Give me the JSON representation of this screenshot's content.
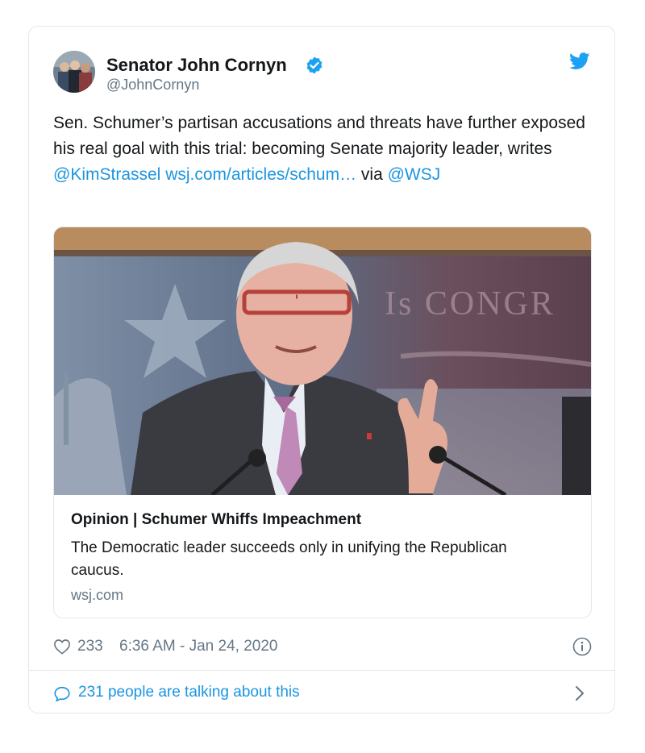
{
  "tweet": {
    "author_name": "Senator John Cornyn",
    "handle": "@JohnCornyn",
    "text": {
      "part1": "Sen. Schumer’s partisan accusations and threats have further exposed his real goal with this trial: becoming Senate majority leader, writes ",
      "mention1": "@KimStrassel",
      "space": " ",
      "url": "wsj.com/articles/schum…",
      "via": " via ",
      "mention2": "@WSJ"
    },
    "link_card": {
      "title": "Opinion | Schumer Whiffs Impeachment",
      "description": "The Democratic leader succeeds only in unifying the Republican caucus.",
      "domain": "wsj.com"
    },
    "likes": "233",
    "timestamp": "6:36 AM - Jan 24, 2020",
    "talking": "231 people are talking about this"
  },
  "icons": {
    "verified": "verified-badge-icon",
    "brand": "twitter-bird-icon",
    "like": "heart-icon",
    "info": "info-icon",
    "reply": "speech-bubble-icon",
    "more": "chevron-right-icon"
  },
  "colors": {
    "link": "#1b95e0",
    "secondary_text": "#657786",
    "border": "#e1e8ed",
    "verified": "#1da1f2"
  }
}
